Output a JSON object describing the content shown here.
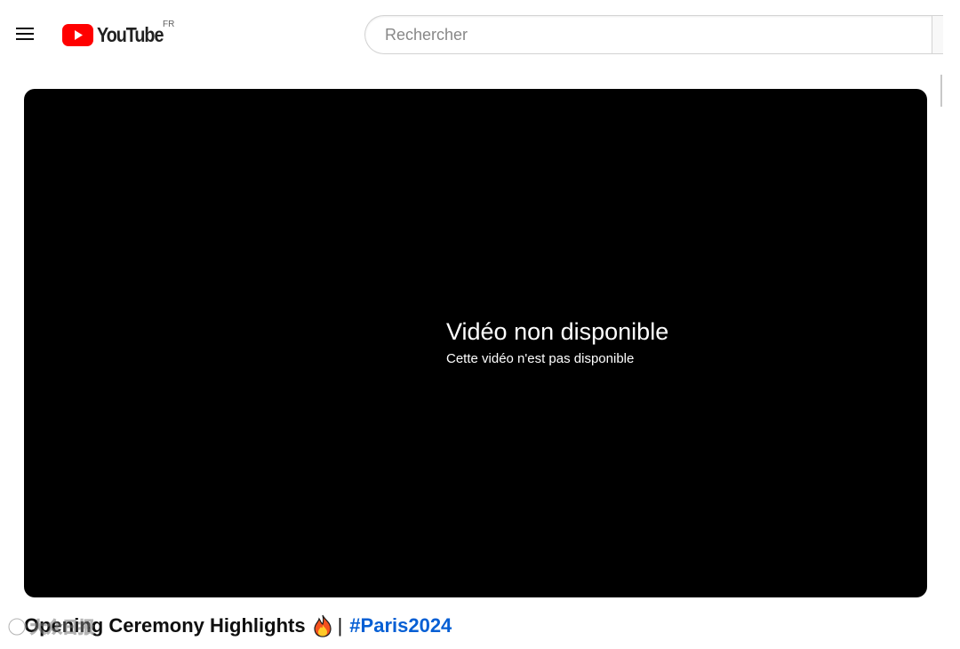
{
  "header": {
    "menu_icon": "hamburger-menu-icon",
    "logo_icon": "youtube-play-icon",
    "logo_text": "YouTube",
    "region_code": "FR",
    "search": {
      "placeholder": "Rechercher",
      "value": ""
    }
  },
  "player": {
    "error_title": "Vidéo non disponible",
    "error_subtitle": "Cette vidéo n'est pas disponible",
    "background_color": "#000000"
  },
  "video": {
    "title": "Opening Ceremony Highlights",
    "title_emoji_icon": "fire-icon",
    "separator": "|",
    "hashtag": "#Paris2024",
    "hashtag_color": "#065fd4"
  },
  "watermark": {
    "text": "大众日报",
    "icon": "watermark-logo-icon"
  },
  "colors": {
    "brand_red": "#ff0000",
    "text_primary": "#0f0f0f",
    "link_blue": "#065fd4"
  }
}
